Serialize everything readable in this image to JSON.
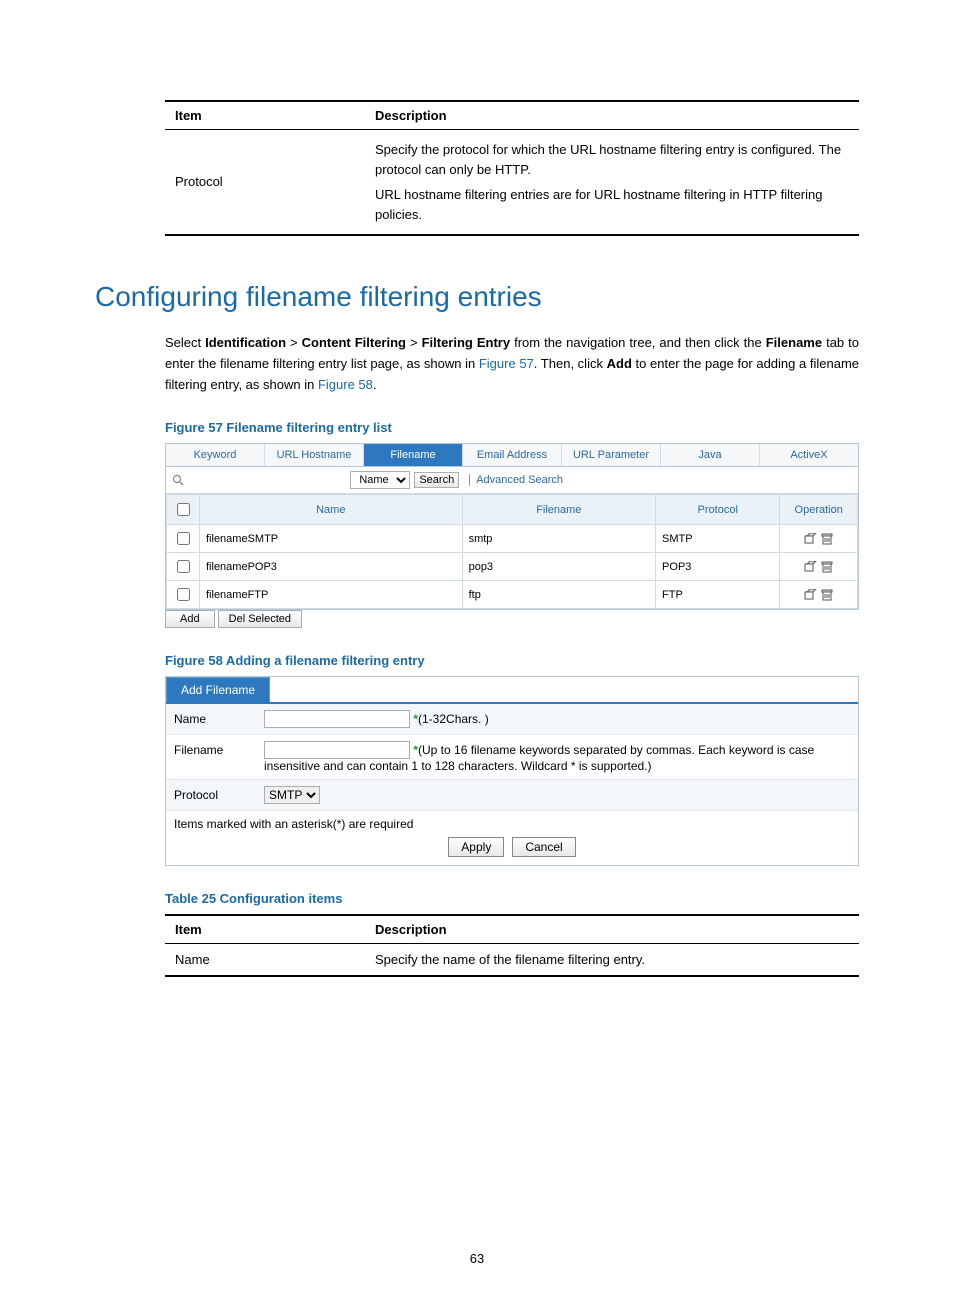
{
  "top_table": {
    "headers": {
      "item": "Item",
      "desc": "Description"
    },
    "row": {
      "item": "Protocol",
      "desc1": "Specify the protocol for which the URL hostname filtering entry is configured. The protocol can only be HTTP.",
      "desc2": "URL hostname filtering entries are for URL hostname filtering in HTTP filtering policies."
    }
  },
  "heading": "Configuring filename filtering entries",
  "para": {
    "p1a": "Select ",
    "b1": "Identification",
    "gt": " > ",
    "b2": "Content Filtering",
    "b3": "Filtering Entry",
    "p1b": " from the navigation tree, and then click the ",
    "b4": "Filename",
    "p1c": " tab to enter the filename filtering entry list page, as shown in ",
    "link1": "Figure 57",
    "p1d": ". Then, click ",
    "b5": "Add",
    "p1e": " to enter the page for adding a filename filtering entry, as shown in ",
    "link2": "Figure 58",
    "p1f": "."
  },
  "fig57": {
    "caption": "Figure 57 Filename filtering entry list",
    "tabs": [
      "Keyword",
      "URL Hostname",
      "Filename",
      "Email Address",
      "URL Parameter",
      "Java",
      "ActiveX"
    ],
    "activeTabIndex": 2,
    "search": {
      "field_option": "Name",
      "button": "Search",
      "advanced": "Advanced Search"
    },
    "columns": {
      "name": "Name",
      "filename": "Filename",
      "protocol": "Protocol",
      "op": "Operation"
    },
    "rows": [
      {
        "name": "filenameSMTP",
        "filename": "smtp",
        "protocol": "SMTP"
      },
      {
        "name": "filenamePOP3",
        "filename": "pop3",
        "protocol": "POP3"
      },
      {
        "name": "filenameFTP",
        "filename": "ftp",
        "protocol": "FTP"
      }
    ],
    "buttons": {
      "add": "Add",
      "del": "Del Selected"
    }
  },
  "fig58": {
    "caption": "Figure 58 Adding a filename filtering entry",
    "tab": "Add Filename",
    "name_label": "Name",
    "name_hint": "(1-32Chars. )",
    "filename_label": "Filename",
    "filename_hint": "(Up to 16 filename keywords separated by commas. Each keyword is case insensitive and can contain 1 to 128 characters. Wildcard * is supported.)",
    "protocol_label": "Protocol",
    "protocol_value": "SMTP",
    "note": "Items marked with an asterisk(*) are required",
    "apply": "Apply",
    "cancel": "Cancel"
  },
  "table25": {
    "caption": "Table 25 Configuration items",
    "headers": {
      "item": "Item",
      "desc": "Description"
    },
    "row": {
      "item": "Name",
      "desc": "Specify the name of the filename filtering entry."
    }
  },
  "page_number": "63"
}
